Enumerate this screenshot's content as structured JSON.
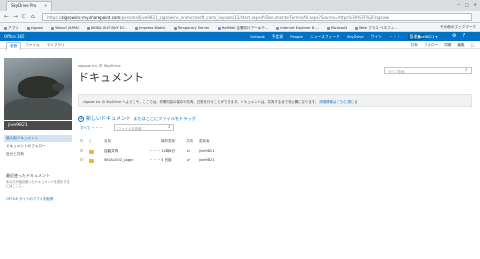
{
  "browser": {
    "tab_title": "SkyDrive Pro",
    "tab_close": "×",
    "window_controls": [
      "─",
      "□",
      "✕"
    ],
    "nav": {
      "back": "←",
      "forward": "→",
      "reload": "C",
      "home": "⌂"
    },
    "url_scheme": "https://",
    "url_host": "zigsowinc-my.sharepoint.com",
    "url_path": "/personal/jive9821_zigsowinc_onmicrosoft_com/_layouts/15/start.aspx#/Documents/Forms/All.aspx?Source=https%3A%2F%2Fzigsowi",
    "bookmarks": [
      "アプリ",
      "zigsow",
      "Yahoo! JAPAN",
      "AKIBA GUY BUY DI...",
      "Impress Watch",
      "Temporary Server",
      "HotMail 企業向けアーキテ...",
      "Internet Explorer 8 ...",
      "Microsoft",
      "Web プラス ベネフィ..."
    ],
    "bookmarks_other": "その他のブックマーク"
  },
  "o365": {
    "title": "Office 365",
    "nav": [
      "Outlook",
      "予定表",
      "People",
      "ニュースフィード",
      "SkyDrive",
      "サイト",
      "・・・",
      "管理者"
    ],
    "user": "jive9821 ▾",
    "icons": [
      "gear-icon",
      "help-icon"
    ],
    "icon_glyphs": [
      "⚙",
      "?"
    ]
  },
  "ribbon": {
    "tabs": [
      "参照",
      "ファイル",
      "ライブラリ"
    ],
    "selected": 0,
    "right": [
      "共有",
      "フォロー",
      "同期",
      "編集",
      "□"
    ]
  },
  "sidebar": {
    "username": "jive9821",
    "items": [
      "個人用ドキュメント",
      "ドキュメントのフォロー",
      "自分と共有"
    ],
    "recent_heading": "最近使ったドキュメント",
    "recent_desc": "あなたが最近使ったドキュメントを表示するにはここに...",
    "get_apps": "OFFICE サイトのアプリを取得"
  },
  "main": {
    "breadcrumb": "zigsow inc の SkyDrive",
    "title": "ドキュメント",
    "search_placeholder": "すべて検索",
    "notice_text": "zigsow inc の SkyDrive へようこそ。ここでは、作業内容の保存や共有、日常を行うことができます。ドキュメントは、共有するまで非公開になります。",
    "notice_link": "詳細情報はこちら",
    "notice_close": "閉じる",
    "new_doc_label": "新しいドキュメント",
    "new_doc_rest": "またはここにファイルをドラッグ",
    "view_all": "すべて",
    "view_dots": "・・・",
    "file_search_placeholder": "ファイルを検索",
    "columns": [
      "名前",
      "最終更新",
      "共有",
      "更新者"
    ],
    "rows": [
      {
        "name": "自動共有",
        "modified": "11時8分",
        "sharing": "⇄",
        "editor": "jive9821",
        "dots": "・・・"
      },
      {
        "name": "WOA1002_Login",
        "modified": "5 日前",
        "sharing": "⇄",
        "editor": "jive9821",
        "dots": "・・・"
      }
    ]
  },
  "colors": {
    "accent": "#0072c6",
    "o365_bar": "#0072c6",
    "folder": "#e8b83e"
  }
}
